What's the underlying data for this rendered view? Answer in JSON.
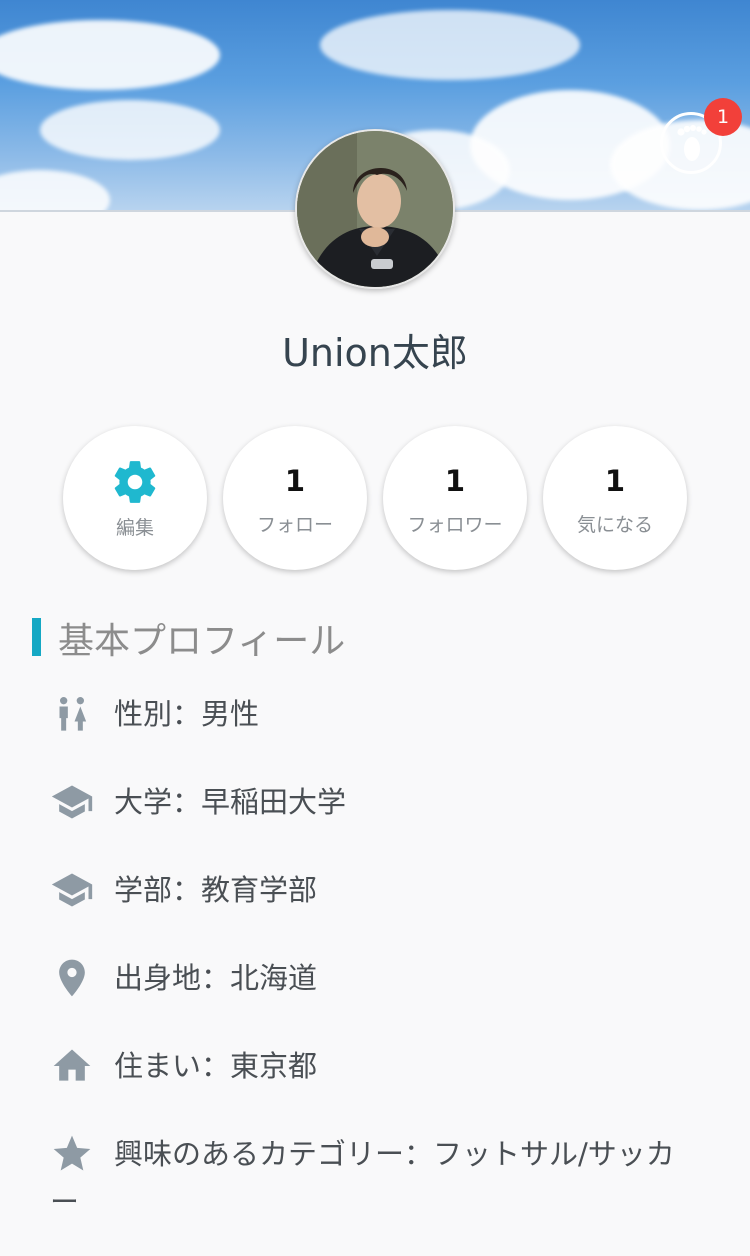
{
  "profile": {
    "name": "Union太郎"
  },
  "header": {
    "footprint_badge": "1"
  },
  "stats": {
    "edit_label": "編集",
    "follow": {
      "count": "1",
      "label": "フォロー"
    },
    "follower": {
      "count": "1",
      "label": "フォロワー"
    },
    "interested": {
      "count": "1",
      "label": "気になる"
    }
  },
  "basic_profile": {
    "title": "基本プロフィール",
    "gender": "性別：男性",
    "university": "大学：早稲田大学",
    "faculty": "学部：教育学部",
    "hometown": "出身地：北海道",
    "residence": "住まい：東京都",
    "interest_line1": "興味のあるカテゴリー：フットサル/サッカ",
    "interest_line2": "ー"
  },
  "colors": {
    "accent": "#15a8c4",
    "badge": "#f2403a",
    "icon_gray": "#8e9aa4"
  },
  "icons": {
    "footprint": "footprint-icon",
    "edit": "gear-icon",
    "gender": "gender-icon",
    "university": "graduation-cap-icon",
    "faculty": "graduation-cap-icon",
    "hometown": "location-pin-icon",
    "residence": "home-icon",
    "interest": "star-icon"
  }
}
